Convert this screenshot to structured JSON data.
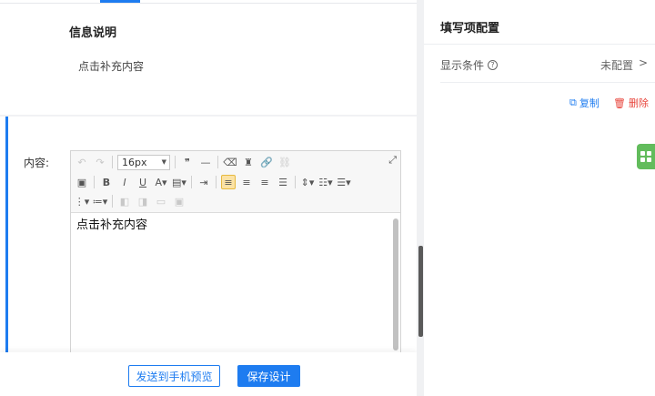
{
  "left": {
    "info_title": "信息说明",
    "info_placeholder": "点击补充内容",
    "content_label": "内容:",
    "editor": {
      "font_size": "16px",
      "body_text": "点击补充内容"
    },
    "footer": {
      "preview_label": "发送到手机预览",
      "save_label": "保存设计"
    }
  },
  "right": {
    "title": "填写项配置",
    "display_condition": {
      "label": "显示条件",
      "value": "未配置"
    },
    "copy_label": "复制",
    "delete_label": "删除"
  },
  "colors": {
    "accent": "#1e7cf0",
    "danger": "#e8453c",
    "widget": "#62bc5c"
  }
}
